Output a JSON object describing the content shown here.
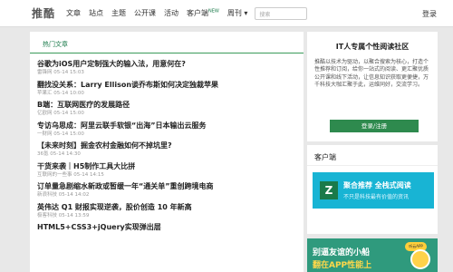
{
  "header": {
    "logo": "推酷",
    "nav": [
      "文章",
      "站点",
      "主题",
      "公开课",
      "活动",
      "客户端",
      "周刊"
    ],
    "nav_badge": "NEW",
    "search_placeholder": "搜索",
    "login": "登录"
  },
  "main": {
    "section_title": "热门文章",
    "items": [
      {
        "title": "谷歌为iOS用户定制强大的输入法，用意何在?",
        "meta": "雷锋网 05-14 15:03"
      },
      {
        "title": "翻找没关系：Larry Ellison谈乔布斯如何决定独裁苹果",
        "meta": "苹果汇 05-14 10:00"
      },
      {
        "title": "B端：互联网医疗的发展路径",
        "meta": "亿欧网 05-14 15:00"
      },
      {
        "title": "专访乌思成：阿里云联手软银“出海”日本输出云服务",
        "meta": "一财网 05-14 15:00"
      },
      {
        "title": "【未来时刻】掘金农村金融如何不掉坑里?",
        "meta": "36氪 05-14 14:30"
      },
      {
        "title": "干货来袭｜H5制作工具大比拼",
        "meta": "互联网的一些事 05-14 14:15"
      },
      {
        "title": "订单量急剧缩水新政或暂缓一年“通关单”重创跨境电商",
        "meta": "新浪科技 05-14 14:02"
      },
      {
        "title": "英伟达 Q1 财报实现逆袭，股价创造 10 年新高",
        "meta": "极客科技 05-14 13:59"
      },
      {
        "title": "HTML5+CSS3+jQuery实现弹出层",
        "meta": ""
      }
    ]
  },
  "sidebar": {
    "promo_title": "IT人专属个性阅读社区",
    "promo_desc": "推酷以技术为驱动，以聚合搜索为核心，打造个性推荐和订阅，给你一站式的阅读、更汇聚优质公开课和线下活动，让信息知识获取更便捷，万千科技大咖汇聚于此，运维同好，交流学习。",
    "promo_button": "登录/注册",
    "client_title": "客户端",
    "client_banner_line1": "聚合推荐 全栈式阅读",
    "client_banner_line2": "不只是科技最有价值的资讯",
    "ad_line1": "别逼友谊的小船",
    "ad_line2": "翻在APP性能上",
    "ad_tag": "听云APP"
  },
  "colors": {
    "accent": "#2e8a4e",
    "banner": "#18b4d4",
    "ad": "#2f9a7d"
  }
}
